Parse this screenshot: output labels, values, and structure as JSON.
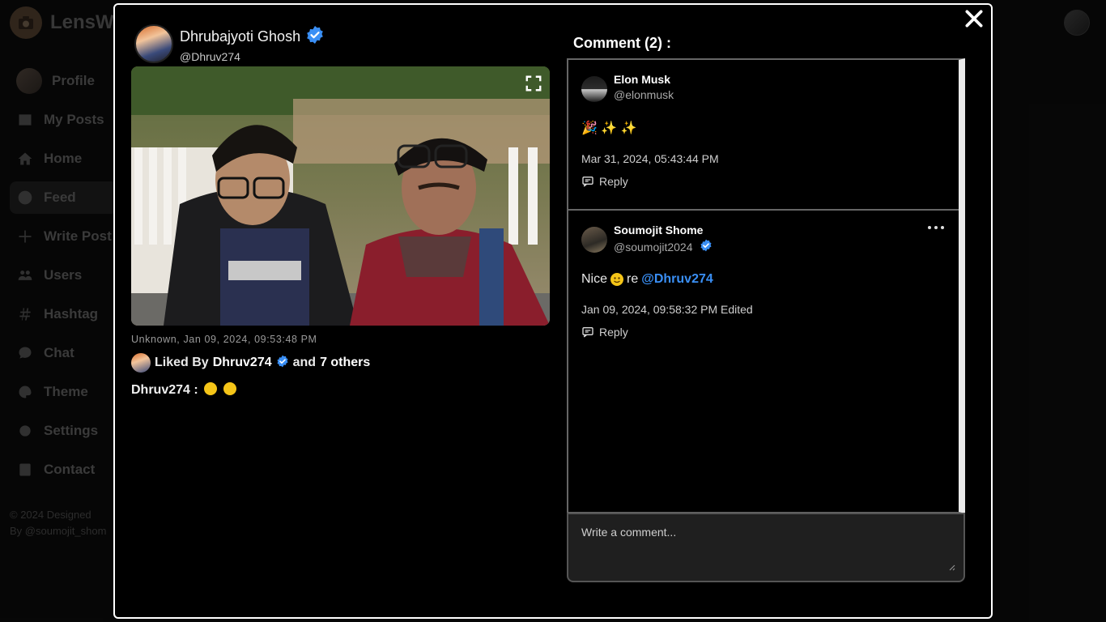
{
  "background": {
    "app_name": "LensW",
    "nav": [
      {
        "label": "Profile",
        "icon": "avatar"
      },
      {
        "label": "My Posts",
        "icon": "image-icon"
      },
      {
        "label": "Home",
        "icon": "home-icon"
      },
      {
        "label": "Feed",
        "icon": "compass-icon"
      },
      {
        "label": "Write Post",
        "icon": "plus-icon"
      },
      {
        "label": "Users",
        "icon": "users-icon"
      },
      {
        "label": "Hashtag",
        "icon": "hashtag-icon"
      },
      {
        "label": "Chat",
        "icon": "chat-icon"
      },
      {
        "label": "Theme",
        "icon": "palette-icon"
      },
      {
        "label": "Settings",
        "icon": "gear-icon"
      },
      {
        "label": "Contact",
        "icon": "contact-icon"
      }
    ],
    "footer_line1": "© 2024 Designed",
    "footer_line2": "By @soumojit_shom"
  },
  "post": {
    "author_name": "Dhrubajyoti Ghosh",
    "author_handle": "@Dhruv274",
    "meta": "Unknown, Jan 09, 2024, 09:53:48 PM",
    "liked_prefix": "Liked By",
    "liked_user": "Dhruv274",
    "liked_suffix": "and",
    "liked_others": "7 others",
    "caption_user": "Dhruv274 :"
  },
  "comments": {
    "title": "Comment (2) :",
    "items": [
      {
        "name": "Elon Musk",
        "handle": "@elonmusk",
        "text": "🎉 ✨ ✨",
        "date": "Mar 31, 2024, 05:43:44 PM",
        "reply_label": "Reply"
      },
      {
        "name": "Soumojit Shome",
        "handle": "@soumojit2024",
        "text_prefix": "Nice",
        "text_middle": "re",
        "mention": "@Dhruv274",
        "date": "Jan 09, 2024, 09:58:32 PM Edited",
        "reply_label": "Reply"
      }
    ],
    "input_placeholder": "Write a comment..."
  },
  "colors": {
    "verified_blue": "#3a8ff5",
    "mention_blue": "#3a8ff5"
  }
}
